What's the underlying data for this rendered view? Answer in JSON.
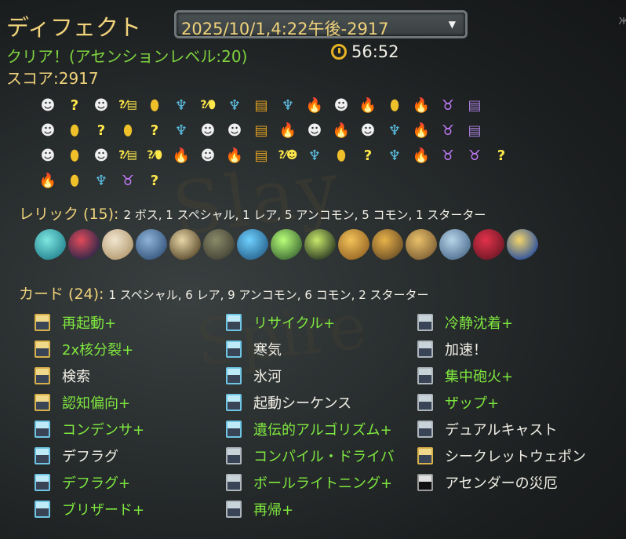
{
  "header": {
    "character": "ディフェクト",
    "run_select": "2025/10/1,4:22午後-2917",
    "result": "クリア！(アセンションレベル:20)",
    "time": "56:52",
    "score": "スコア:2917",
    "corner_glyph": "ж"
  },
  "map_path": {
    "rows": [
      [
        "monster",
        "unknown",
        "monster",
        "unknown-chest",
        "shop",
        "elite",
        "unknown-shop",
        "elite",
        "chest",
        "elite",
        "rest",
        "monster",
        "rest",
        "shop",
        "rest",
        "boss",
        "boss-chest"
      ],
      [
        "monster",
        "shop",
        "unknown",
        "shop",
        "unknown",
        "elite",
        "monster",
        "monster",
        "chest",
        "rest",
        "monster",
        "rest",
        "monster",
        "elite",
        "rest",
        "boss",
        "boss-chest"
      ],
      [
        "monster",
        "shop",
        "monster",
        "unknown-chest",
        "unknown-shop",
        "rest",
        "monster",
        "rest",
        "chest",
        "unknown-monster",
        "elite",
        "shop",
        "unknown",
        "elite",
        "rest",
        "boss",
        "boss",
        "unknown"
      ],
      [
        "rest",
        "shop",
        "elite",
        "boss",
        "unknown"
      ]
    ],
    "glyphs": {
      "monster": "☻",
      "unknown": "?",
      "shop": "⬮",
      "elite": "♆",
      "rest": "🔥",
      "chest": "▤",
      "boss": "♉",
      "boss-chest": "▤",
      "unknown-chest": "?⁄▤",
      "unknown-shop": "?⁄⬮",
      "unknown-monster": "?⁄☻"
    }
  },
  "relics": {
    "label": "レリック (15):",
    "summary": "2 ボス, 1 スペシャル, 1 レア, 5 アンコモン, 5 コモン, 1 スターター",
    "items": [
      {
        "name": "orb-relic-icon",
        "c1": "#7ee6e0",
        "c2": "#2f8f9a"
      },
      {
        "name": "mushroom-relic-icon",
        "c1": "#e24a5a",
        "c2": "#3a2a4a"
      },
      {
        "name": "egg-relic-icon",
        "c1": "#f2e6d0",
        "c2": "#b9a27a"
      },
      {
        "name": "anchor-relic-icon",
        "c1": "#8fb4d8",
        "c2": "#3f5f86"
      },
      {
        "name": "hourglass-relic-icon",
        "c1": "#e8d6a8",
        "c2": "#6b5a3a"
      },
      {
        "name": "stone-egg-relic-icon",
        "c1": "#8a8a6a",
        "c2": "#4a4a3a"
      },
      {
        "name": "ring-relic-icon",
        "c1": "#6fd0ff",
        "c2": "#2f6f9a"
      },
      {
        "name": "scroll-relic-icon",
        "c1": "#b9ff7a",
        "c2": "#4a7a3a"
      },
      {
        "name": "jar-relic-icon",
        "c1": "#c8e86a",
        "c2": "#3a4a2a"
      },
      {
        "name": "leaf-relic-icon",
        "c1": "#f2c25a",
        "c2": "#a0702a"
      },
      {
        "name": "crane-relic-icon",
        "c1": "#e8b24a",
        "c2": "#7a5a2a"
      },
      {
        "name": "sundial-relic-icon",
        "c1": "#e8c06a",
        "c2": "#8a6a3a"
      },
      {
        "name": "beads-relic-icon",
        "c1": "#b8d4e8",
        "c2": "#5a7a9a"
      },
      {
        "name": "potion-relic-icon",
        "c1": "#e2324a",
        "c2": "#7a1a2a"
      },
      {
        "name": "feather-relic-icon",
        "c1": "#f2d46a",
        "c2": "#3a5a9a"
      }
    ]
  },
  "cards": {
    "label": "カード (24):",
    "summary": "1 スペシャル, 6 レア, 9 アンコモン, 6 コモン, 2 スターター",
    "col1": [
      {
        "name": "再起動+",
        "up": true,
        "icon": "gold"
      },
      {
        "name": "2x核分裂+",
        "up": true,
        "icon": "gold"
      },
      {
        "name": "検索",
        "up": false,
        "icon": "gold"
      },
      {
        "name": "認知偏向+",
        "up": true,
        "icon": "gold"
      },
      {
        "name": "コンデンサ+",
        "up": true,
        "icon": "cyan"
      },
      {
        "name": "デフラグ",
        "up": false,
        "icon": "cyan"
      },
      {
        "name": "デフラグ+",
        "up": true,
        "icon": "cyan"
      },
      {
        "name": "ブリザード+",
        "up": true,
        "icon": "cyan"
      }
    ],
    "col2": [
      {
        "name": "リサイクル+",
        "up": true,
        "icon": "cyan"
      },
      {
        "name": "寒気",
        "up": false,
        "icon": "cyan"
      },
      {
        "name": "氷河",
        "up": false,
        "icon": "cyan"
      },
      {
        "name": "起動シーケンス",
        "up": false,
        "icon": "cyan"
      },
      {
        "name": "遺伝的アルゴリズム+",
        "up": true,
        "icon": "cyan"
      },
      {
        "name": "コンパイル・ドライバ",
        "up": true,
        "icon": "grey"
      },
      {
        "name": "ボールライトニング+",
        "up": true,
        "icon": "grey"
      },
      {
        "name": "再帰+",
        "up": true,
        "icon": "grey"
      }
    ],
    "col3": [
      {
        "name": "冷静沈着+",
        "up": true,
        "icon": "grey"
      },
      {
        "name": "加速！",
        "up": false,
        "icon": "grey"
      },
      {
        "name": "集中砲火+",
        "up": true,
        "icon": "grey"
      },
      {
        "name": "ザップ+",
        "up": true,
        "icon": "grey"
      },
      {
        "name": "デュアルキャスト",
        "up": false,
        "icon": "grey"
      },
      {
        "name": "シークレットウェポン",
        "up": false,
        "icon": "gold"
      },
      {
        "name": "アセンダーの災厄",
        "up": false,
        "icon": "dark"
      }
    ]
  }
}
